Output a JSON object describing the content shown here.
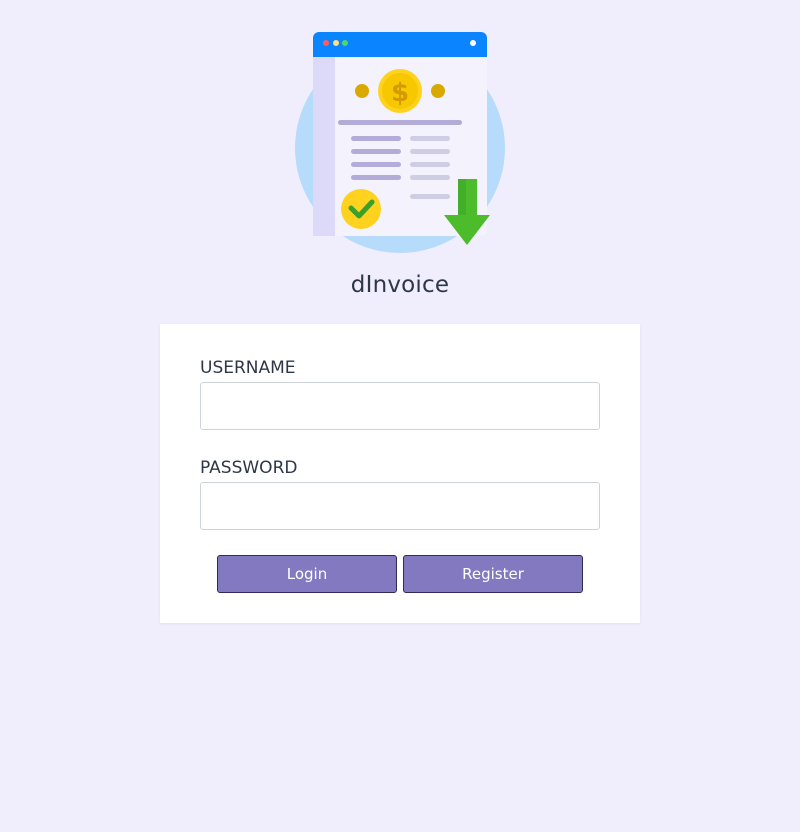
{
  "app": {
    "title": "dInvoice"
  },
  "logo": {
    "icon": "invoice-download-icon",
    "colors": {
      "circle": "#b7dcfb",
      "window_bar": "#0a84ff",
      "coin": "#ffd21f",
      "check": "#ffd21f",
      "arrow": "#4cbc2a"
    }
  },
  "login_form": {
    "username_label": "USERNAME",
    "username_value": "",
    "password_label": "PASSWORD",
    "password_value": "",
    "login_label": "Login",
    "register_label": "Register"
  },
  "colors": {
    "background": "#f0eefc",
    "card": "#ffffff",
    "button": "#8279c0",
    "text": "#2d3748"
  }
}
